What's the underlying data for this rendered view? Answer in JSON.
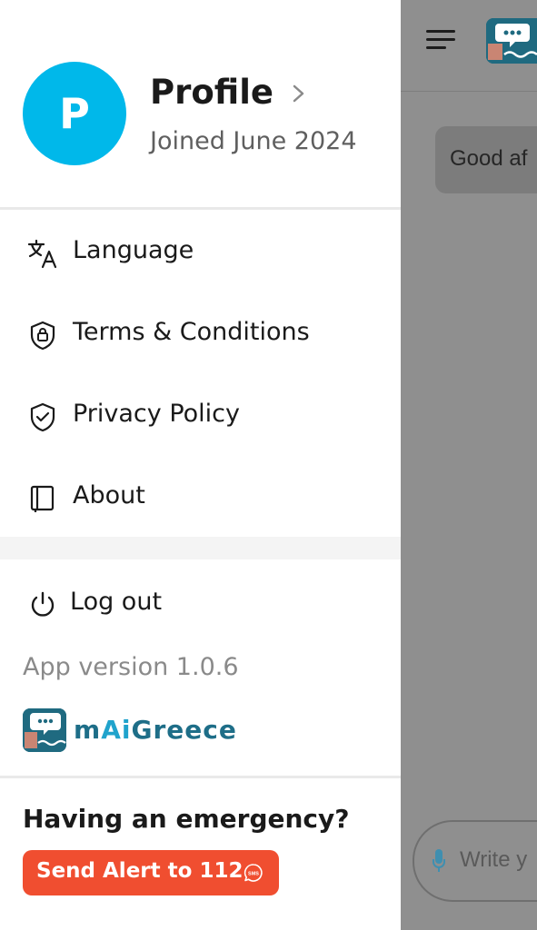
{
  "profile": {
    "avatar_letter": "P",
    "name": "Profile",
    "joined": "Joined June 2024"
  },
  "menu": {
    "items": [
      {
        "label": "Language",
        "icon": "translate-icon"
      },
      {
        "label": "Terms & Conditions",
        "icon": "shield-lock-icon"
      },
      {
        "label": "Privacy Policy",
        "icon": "shield-check-icon"
      },
      {
        "label": "About",
        "icon": "book-icon"
      }
    ],
    "logout_label": "Log out"
  },
  "app": {
    "version_text": "App version 1.0.6",
    "brand_prefix": "m",
    "brand_ai": "Ai",
    "brand_suffix": "Greece"
  },
  "emergency": {
    "title": "Having an emergency?",
    "button_label": "Send Alert to 112",
    "sms_icon_text": "SMS"
  },
  "background": {
    "greeting_text": "Good af",
    "input_placeholder": "Write y"
  },
  "colors": {
    "avatar": "#00b8ea",
    "alert_button": "#f04e30",
    "brand_dark": "#1e6e88",
    "brand_light": "#20a3cc",
    "overlay": "#8f8f8f"
  }
}
